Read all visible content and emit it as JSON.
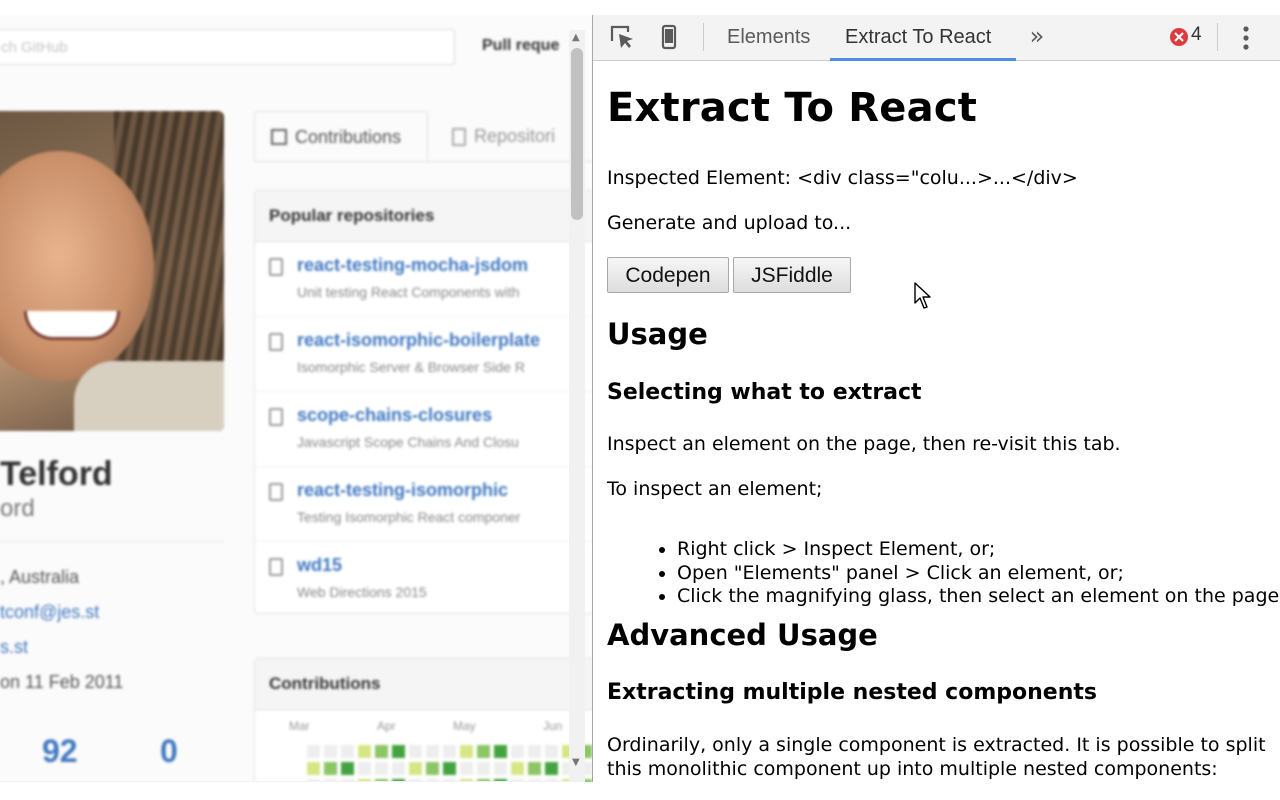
{
  "github_page": {
    "search_placeholder": "ch GitHub",
    "nav_pull_requests": "Pull reque",
    "profile": {
      "name": "Telford",
      "username": "ord",
      "location": ", Australia",
      "email": "tconf@jes.st",
      "website": "s.st",
      "joined": "on 11 Feb 2011",
      "stat_a": "92",
      "stat_b": "0"
    },
    "tabs": {
      "contributions": "Contributions",
      "repositories": "Repositori"
    },
    "popular_repos": {
      "heading": "Popular repositories",
      "items": [
        {
          "name": "react-testing-mocha-jsdom",
          "desc": "Unit testing React Components with"
        },
        {
          "name": "react-isomorphic-boilerplate",
          "desc": "Isomorphic Server & Browser Side R"
        },
        {
          "name": "scope-chains-closures",
          "desc": "Javascript Scope Chains And Closu"
        },
        {
          "name": "react-testing-isomorphic",
          "desc": "Testing Isomorphic React componer"
        },
        {
          "name": "wd15",
          "desc": "Web Directions 2015"
        }
      ]
    },
    "contributions_box": {
      "heading": "Contributions",
      "months": [
        "Mar",
        "Apr",
        "May",
        "Jun"
      ]
    }
  },
  "devtools": {
    "tabs": [
      {
        "label": "Elements",
        "active": false
      },
      {
        "label": "Extract To React",
        "active": true
      }
    ],
    "error_count": "4",
    "accent_color": "#4d8de8",
    "error_color": "#e0393e",
    "panel": {
      "title": "Extract To React",
      "inspected_element": "Inspected Element: <div class=\"colu...>...</div>",
      "generate_text": "Generate and upload to...",
      "buttons": {
        "codepen": "Codepen",
        "jsfiddle": "JSFiddle"
      },
      "usage_heading": "Usage",
      "selecting_heading": "Selecting what to extract",
      "inspect_text": "Inspect an element on the page, then re-visit this tab.",
      "to_inspect_text": "To inspect an element;",
      "steps": [
        "Right click > Inspect Element, or;",
        "Open \"Elements\" panel > Click an element, or;",
        "Click the magnifying glass, then select an element on the page"
      ],
      "advanced_heading": "Advanced Usage",
      "nested_heading": "Extracting multiple nested components",
      "nested_text_1": "Ordinarily, only a single component is extracted. It is possible to split",
      "nested_text_2": "this monolithic component up into multiple nested components:"
    }
  }
}
